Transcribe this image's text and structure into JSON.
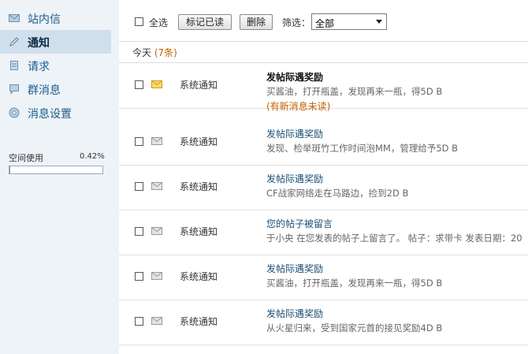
{
  "sidebar": {
    "items": [
      {
        "label": "站内信",
        "icon": "envelope-icon"
      },
      {
        "label": "通知",
        "icon": "pencil-icon"
      },
      {
        "label": "请求",
        "icon": "document-icon"
      },
      {
        "label": "群消息",
        "icon": "chat-bubble-icon"
      },
      {
        "label": "消息设置",
        "icon": "settings-icon"
      }
    ],
    "active_index": 1,
    "space_usage": {
      "label": "空间使用",
      "value": "0.42%",
      "fraction": 0.0042
    }
  },
  "toolbar": {
    "select_all_label": "全选",
    "mark_read_label": "标记已读",
    "delete_label": "删除",
    "filter_label": "筛选：",
    "filter_value": "全部"
  },
  "section": {
    "today_label": "今天",
    "count_text": "(7条)"
  },
  "messages": [
    {
      "type": "系统通知",
      "title": "发帖际遇奖励",
      "desc": "买酱油，打开瓶盖，发现再来一瓶，得5D B",
      "unread": true,
      "new_flag": "(有新消息未读)"
    },
    {
      "type": "系统通知",
      "title": "发帖际遇奖励",
      "desc": "发现、检举斑竹工作时间泡MM，管理给予5D B",
      "unread": false
    },
    {
      "type": "系统通知",
      "title": "发帖际遇奖励",
      "desc": "CF战家网络走在马路边，捡到2D B",
      "unread": false
    },
    {
      "type": "系统通知",
      "title": "您的帖子被留言",
      "desc": "于小央 在您发表的帖子上留言了。 帖子：求带卡 发表日期：20",
      "unread": false
    },
    {
      "type": "系统通知",
      "title": "发帖际遇奖励",
      "desc": "买酱油，打开瓶盖，发现再来一瓶，得5D B",
      "unread": false
    },
    {
      "type": "系统通知",
      "title": "发帖际遇奖励",
      "desc": "从火星归来，受到国家元首的接见奖励4D B",
      "unread": false
    }
  ],
  "colors": {
    "accent": "#1a5d8c",
    "sidebar_bg": "#eef3f8",
    "active_bg": "#cfdfec",
    "highlight": "#c06000"
  }
}
